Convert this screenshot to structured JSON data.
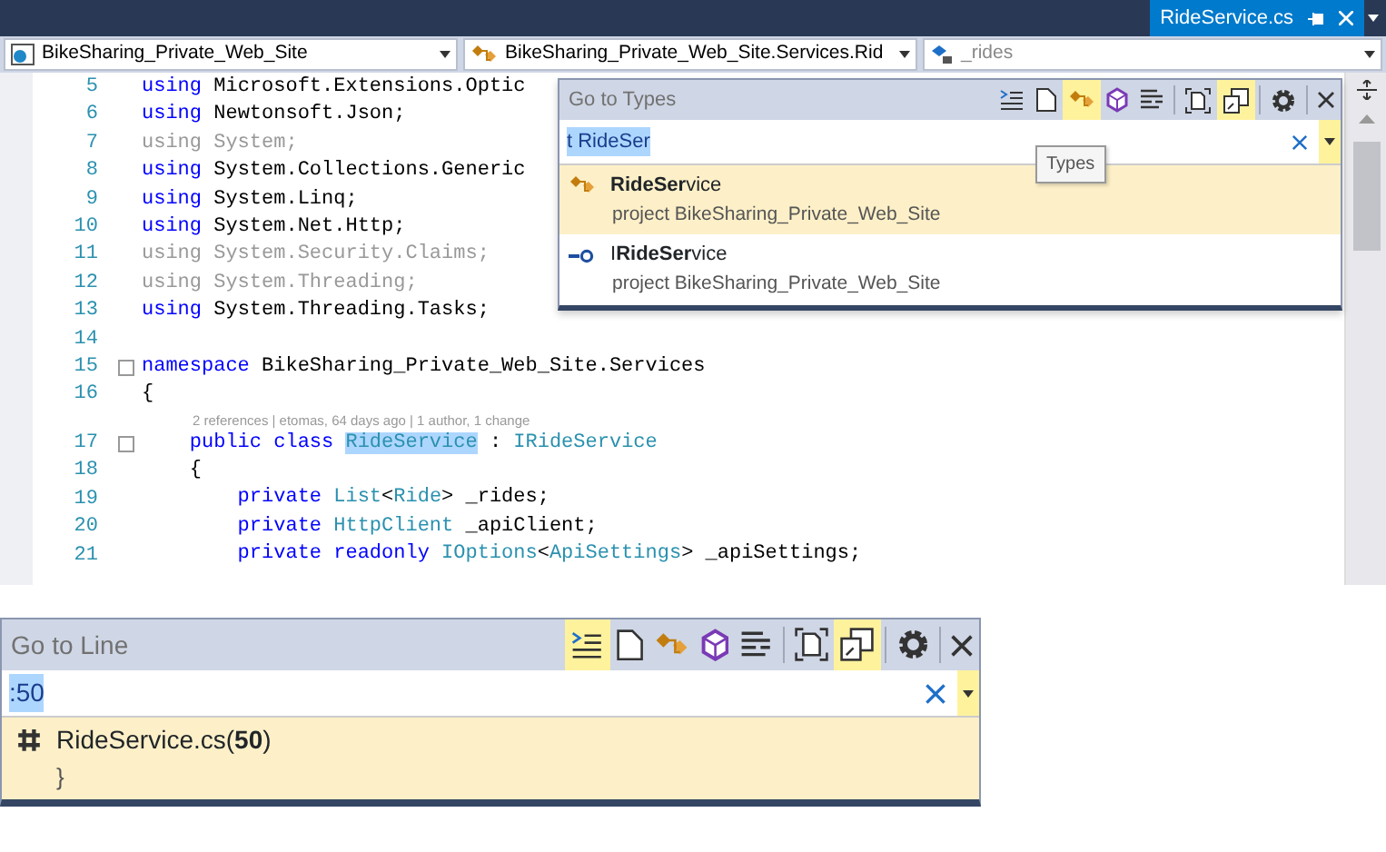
{
  "document_tab": {
    "title": "RideService.cs",
    "selected": true
  },
  "navigation_bar": {
    "project": "BikeSharing_Private_Web_Site",
    "type": "BikeSharing_Private_Web_Site.Services.Rid",
    "member": "_rides"
  },
  "code_lines": [
    {
      "number": "5",
      "segments": [
        {
          "text": "using",
          "kind": "keyword"
        },
        {
          "text": " Microsoft.Extensions.Optic",
          "kind": "plain"
        }
      ]
    },
    {
      "number": "6",
      "segments": [
        {
          "text": "using",
          "kind": "keyword"
        },
        {
          "text": " Newtonsoft.Json;",
          "kind": "plain"
        }
      ]
    },
    {
      "number": "7",
      "segments": [
        {
          "text": "using System;",
          "kind": "faded"
        }
      ]
    },
    {
      "number": "8",
      "segments": [
        {
          "text": "using",
          "kind": "keyword"
        },
        {
          "text": " System.Collections.Generic",
          "kind": "plain"
        }
      ]
    },
    {
      "number": "9",
      "segments": [
        {
          "text": "using",
          "kind": "keyword"
        },
        {
          "text": " System.Linq;",
          "kind": "plain"
        }
      ]
    },
    {
      "number": "10",
      "segments": [
        {
          "text": "using",
          "kind": "keyword"
        },
        {
          "text": " System.Net.Http;",
          "kind": "plain"
        }
      ]
    },
    {
      "number": "11",
      "segments": [
        {
          "text": "using System.Security.Claims;",
          "kind": "faded"
        }
      ]
    },
    {
      "number": "12",
      "segments": [
        {
          "text": "using System.Threading;",
          "kind": "faded"
        }
      ]
    },
    {
      "number": "13",
      "segments": [
        {
          "text": "using",
          "kind": "keyword"
        },
        {
          "text": " System.Threading.Tasks;",
          "kind": "plain"
        }
      ]
    },
    {
      "number": "14"
    },
    {
      "number": "15",
      "fold": true,
      "segments": [
        {
          "text": "namespace",
          "kind": "keyword"
        },
        {
          "text": " BikeSharing_Private_Web_Site.Services",
          "kind": "plain"
        }
      ]
    },
    {
      "number": "16",
      "segments": [
        {
          "text": "{",
          "kind": "plain"
        }
      ]
    },
    {
      "codelens": "2 references | etomas, 64 days ago | 1 author, 1 change"
    },
    {
      "number": "17",
      "fold": true,
      "segments": [
        {
          "text": "    public class ",
          "kind": "keyword"
        },
        {
          "text": "RideService",
          "kind": "highlight"
        },
        {
          "text": " : ",
          "kind": "plain"
        },
        {
          "text": "IRideService",
          "kind": "type"
        }
      ]
    },
    {
      "number": "18",
      "segments": [
        {
          "text": "    {",
          "kind": "plain"
        }
      ]
    },
    {
      "number": "19",
      "segments": [
        {
          "text": "        private ",
          "kind": "keyword"
        },
        {
          "text": "List",
          "kind": "type"
        },
        {
          "text": "<",
          "kind": "plain"
        },
        {
          "text": "Ride",
          "kind": "type"
        },
        {
          "text": "> _rides;",
          "kind": "plain"
        }
      ]
    },
    {
      "number": "20",
      "segments": [
        {
          "text": "        private ",
          "kind": "keyword"
        },
        {
          "text": "HttpClient",
          "kind": "type"
        },
        {
          "text": " _apiClient;",
          "kind": "plain"
        }
      ]
    },
    {
      "number": "21",
      "segments": [
        {
          "text": "        private readonly ",
          "kind": "keyword"
        },
        {
          "text": "IOptions",
          "kind": "type"
        },
        {
          "text": "<",
          "kind": "plain"
        },
        {
          "text": "ApiSettings",
          "kind": "type"
        },
        {
          "text": "> _apiSettings;",
          "kind": "plain"
        }
      ]
    }
  ],
  "go_to_types": {
    "title": "Go to Types",
    "toolbar": [
      {
        "kind": "lines",
        "selected": false
      },
      {
        "kind": "file",
        "selected": false
      },
      {
        "kind": "class",
        "selected": true
      },
      {
        "kind": "cube",
        "selected": false
      },
      {
        "kind": "members",
        "selected": false
      },
      {
        "kind": "frame",
        "selected": false
      },
      {
        "kind": "windows",
        "selected": true
      },
      {
        "kind": "gear",
        "selected": false
      },
      {
        "kind": "close",
        "selected": false
      }
    ],
    "search_value": "t RideSer",
    "tooltip": "Types",
    "results": [
      {
        "kind": "class",
        "name": "**RideSer**vice",
        "detail": "project BikeSharing_Private_Web_Site",
        "selected": true
      },
      {
        "kind": "interface",
        "name": "I**RideSer**vice",
        "detail": "project BikeSharing_Private_Web_Site",
        "selected": false
      }
    ]
  },
  "go_to_line": {
    "title": "Go to Line",
    "toolbar": [
      {
        "kind": "lines",
        "selected": true
      },
      {
        "kind": "file",
        "selected": false
      },
      {
        "kind": "class",
        "selected": false
      },
      {
        "kind": "cube",
        "selected": false
      },
      {
        "kind": "members",
        "selected": false
      },
      {
        "kind": "frame",
        "selected": false
      },
      {
        "kind": "windows",
        "selected": true
      },
      {
        "kind": "gear",
        "selected": false
      },
      {
        "kind": "close",
        "selected": false
      }
    ],
    "search_value": ":50",
    "results": [
      {
        "kind": "line",
        "name": "RideService.cs(**50**)",
        "detail": "}",
        "selected": true
      }
    ]
  }
}
